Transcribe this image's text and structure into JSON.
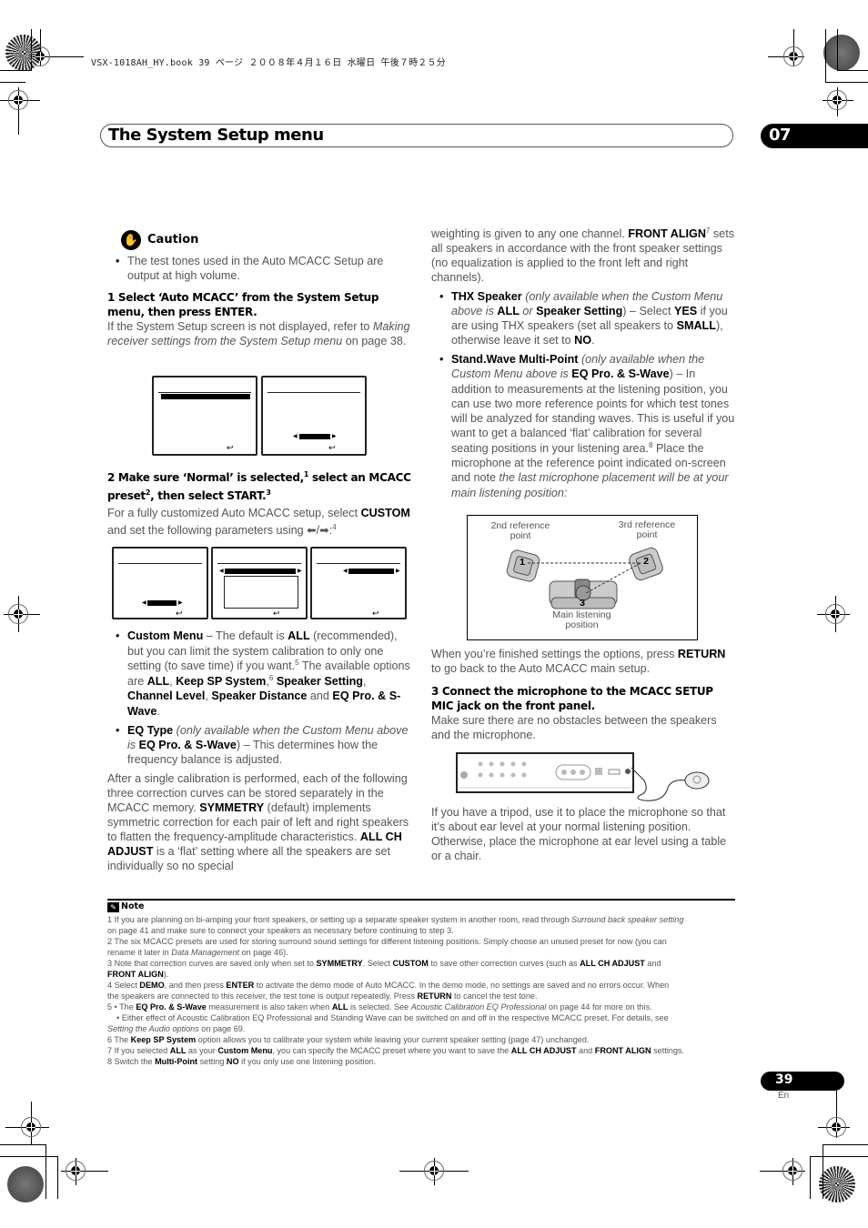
{
  "print_header": "VSX-1018AH_HY.book  39 ページ  ２００８年４月１６日  水曜日  午後７時２５分",
  "header": {
    "title": "The System Setup menu",
    "chapter": "07"
  },
  "caution": {
    "icon": "hand-stop-icon",
    "label": "Caution",
    "bullet": "The test tones used in the Auto MCACC Setup are output at high volume."
  },
  "step1": {
    "heading": "1    Select ‘Auto MCACC’ from the System Setup menu, then press ENTER.",
    "body_pre": "If the System Setup screen is not displayed, refer to ",
    "body_italic": "Making receiver settings from the System Setup menu",
    "body_post": " on page 38."
  },
  "step2": {
    "heading_a": "2    Make sure ‘Normal’ is selected,",
    "sup1": "1",
    "heading_b": " select an MCACC preset",
    "sup2": "2",
    "heading_c": ", then select START.",
    "sup3": "3",
    "body_pre": "For a fully customized Auto MCACC setup, select ",
    "body_bold": "CUSTOM",
    "body_post": " and set the following parameters using ⬅/➡:",
    "sup4": "4"
  },
  "custom_menu": {
    "term": "Custom Menu",
    "t1": " – The default is ",
    "all": "ALL",
    "t2": " (recommended), but you can limit the system calibration to only one setting (to save time) if you want.",
    "sup5": "5",
    "t3": " The available options are ",
    "opt1": "ALL",
    "comma": ", ",
    "opt2": "Keep SP System",
    "sup6": "6",
    "opt3": "Speaker Setting",
    "opt4": "Channel Level",
    "opt5": "Speaker Distance",
    "and": " and ",
    "opt6": "EQ Pro. & S-Wave",
    "period": "."
  },
  "eq_type": {
    "term": "EQ Type",
    "i1": "(only available when the Custom Menu above is ",
    "b1": "EQ Pro. & S-Wave",
    "t2": ") – This determines how the frequency balance is adjusted."
  },
  "calibration_para": {
    "t1": "After a single calibration is performed, each of the following three correction curves can be stored separately in the MCACC memory. ",
    "b1": "SYMMETRY",
    "t2": " (default) implements symmetric correction for each pair of left and right speakers to flatten the frequency-amplitude characteristics. ",
    "b2": "ALL CH ADJUST",
    "t3": " is a ‘flat’ setting where all the speakers are set individually so no special weighting is given to any one channel. ",
    "b3": "FRONT ALIGN",
    "sup7": "7",
    "t4": " sets all speakers in accordance with the front speaker settings (no equalization is applied to the front left and right channels)."
  },
  "thx_speaker": {
    "term": "THX Speaker",
    "i1": "(only available when the Custom Menu above is ",
    "b1": "ALL",
    "i2": " or ",
    "b2": "Speaker Setting",
    "t1": ") – Select ",
    "b3": "YES",
    "t2": " if you are using THX speakers (set all speakers to ",
    "b4": "SMALL",
    "t3": "), otherwise leave it set to ",
    "b5": "NO",
    "t4": "."
  },
  "standwave": {
    "term": "Stand.Wave Multi-Point",
    "i1": "(only available when the Custom Menu above is ",
    "b1": "EQ Pro. & S-Wave",
    "t1": ") – In addition to measurements at the listening position, you can use two more reference points for which test tones will be analyzed for standing waves. This is useful if you want to get a balanced ‘flat’ calibration for several seating positions in your listening area.",
    "sup8": "8",
    "t2": " Place the microphone at the reference point indicated on-screen and note ",
    "i2": "the last microphone placement will be at your main listening position:"
  },
  "diagram": {
    "label_2nd": "2nd reference point",
    "label_3rd": "3rd reference point",
    "label_main": "Main listening position",
    "num1": "1",
    "num2": "2",
    "num3": "3"
  },
  "finished_para": {
    "t1": "When you’re finished settings the options, press ",
    "b1": "RETURN",
    "t2": " to go back to the Auto MCACC main setup."
  },
  "step3": {
    "heading": "3    Connect the microphone to the MCACC SETUP MIC jack on the front panel.",
    "body": "Make sure there are no obstacles between the speakers and the microphone."
  },
  "tripod_para": "If you have a tripod, use it to place the microphone so that it’s about ear level at your normal listening position. Otherwise, place the microphone at ear level using a table or a chair.",
  "notes": {
    "label": "Note",
    "n1a": "1  If you are planning on bi-amping your front speakers, or setting up a separate speaker system in another room, read through ",
    "n1i": "Surround back speaker setting",
    "n1b": "on page 41 and make sure to connect your speakers as necessary before continuing to step 3.",
    "n2a": "2  The six MCACC presets are used for storing surround sound settings for different listening positions. Simply choose an unused preset for now (you can",
    "n2b_pre": "rename it later in ",
    "n2b_i": "Data Management",
    "n2b_post": " on page 46).",
    "n3_pre": "3  Note that correction curves are saved only when set to ",
    "n3_b1": "SYMMETRY",
    "n3_mid": ". Select ",
    "n3_b2": "CUSTOM",
    "n3_mid2": " to save other correction curves (such as ",
    "n3_b3": "ALL CH ADJUST",
    "n3_end": " and",
    "n3_b4": "FRONT ALIGN",
    "n3_close": ").",
    "n4_pre": "4  Select ",
    "n4_b1": "DEMO",
    "n4_mid": ", and then press ",
    "n4_b2": "ENTER",
    "n4_post": " to activate the demo mode of Auto MCACC. In the demo mode, no settings are saved and no errors occur. When",
    "n4b_pre": "the speakers are connected to this receiver, the test tone is output repeatedly. Press ",
    "n4b_b": "RETURN",
    "n4b_post": " to cancel the test tone.",
    "n5_pre": "5  • The ",
    "n5_b1": "EQ Pro. & S-Wave",
    "n5_mid": " measurement is also taken when ",
    "n5_b2": "ALL",
    "n5_mid2": " is selected. See ",
    "n5_i": "Acoustic Calibration EQ Professional",
    "n5_post": " on page 44 for more on this.",
    "n5b": "    • Either effect of Acoustic Calibration EQ Professional and Standing Wave can be switched on and off in the respective MCACC preset. For details, see",
    "n5c_i": "Setting the Audio options",
    "n5c_post": " on page 69.",
    "n6_pre": "6  The ",
    "n6_b": "Keep SP System",
    "n6_post": " option allows you to calibrate your system while leaving your current speaker setting (page 47) unchanged.",
    "n7_pre": "7  If you selected ",
    "n7_b1": "ALL",
    "n7_mid": " as your ",
    "n7_b2": "Custom Menu",
    "n7_mid2": ", you can specify the MCACC preset where you want to save the ",
    "n7_b3": "ALL CH ADJUST",
    "n7_and": " and ",
    "n7_b4": "FRONT ALIGN",
    "n7_post": " settings.",
    "n8_pre": "8  Switch the ",
    "n8_b1": "Multi-Point",
    "n8_mid": " setting ",
    "n8_b2": "NO",
    "n8_post": " if you only use one listening position."
  },
  "footer": {
    "page_number": "39",
    "language": "En"
  },
  "screens": {
    "return_icon": "↩"
  }
}
